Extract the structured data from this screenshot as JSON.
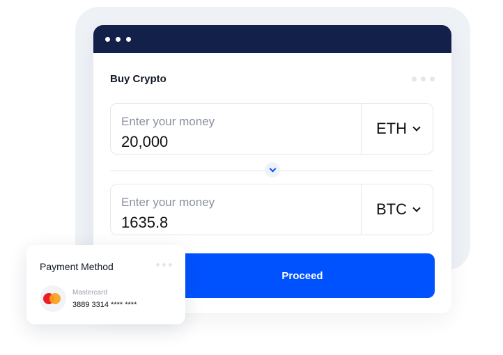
{
  "widget": {
    "title": "Buy Crypto"
  },
  "from_field": {
    "label": "Enter your money",
    "value": "20,000",
    "currency": "ETH"
  },
  "to_field": {
    "label": "Enter your money",
    "value": "1635.8",
    "currency": "BTC"
  },
  "actions": {
    "proceed_label": "Proceed"
  },
  "payment": {
    "title": "Payment Method",
    "brand": "Mastercard",
    "card_number": "3889 3314 **** ****"
  },
  "icons": {
    "window_dots": "window-dots-icon",
    "more": "more-dots-icon",
    "chevron": "chevron-down-icon",
    "swap": "swap-chevron-icon",
    "card_brand": "mastercard-icon"
  },
  "colors": {
    "titlebar": "#13214a",
    "accent": "#0052ff",
    "backdrop": "#eef1f6",
    "mastercard_red": "#eb1c26",
    "mastercard_orange": "#f7a21b"
  }
}
